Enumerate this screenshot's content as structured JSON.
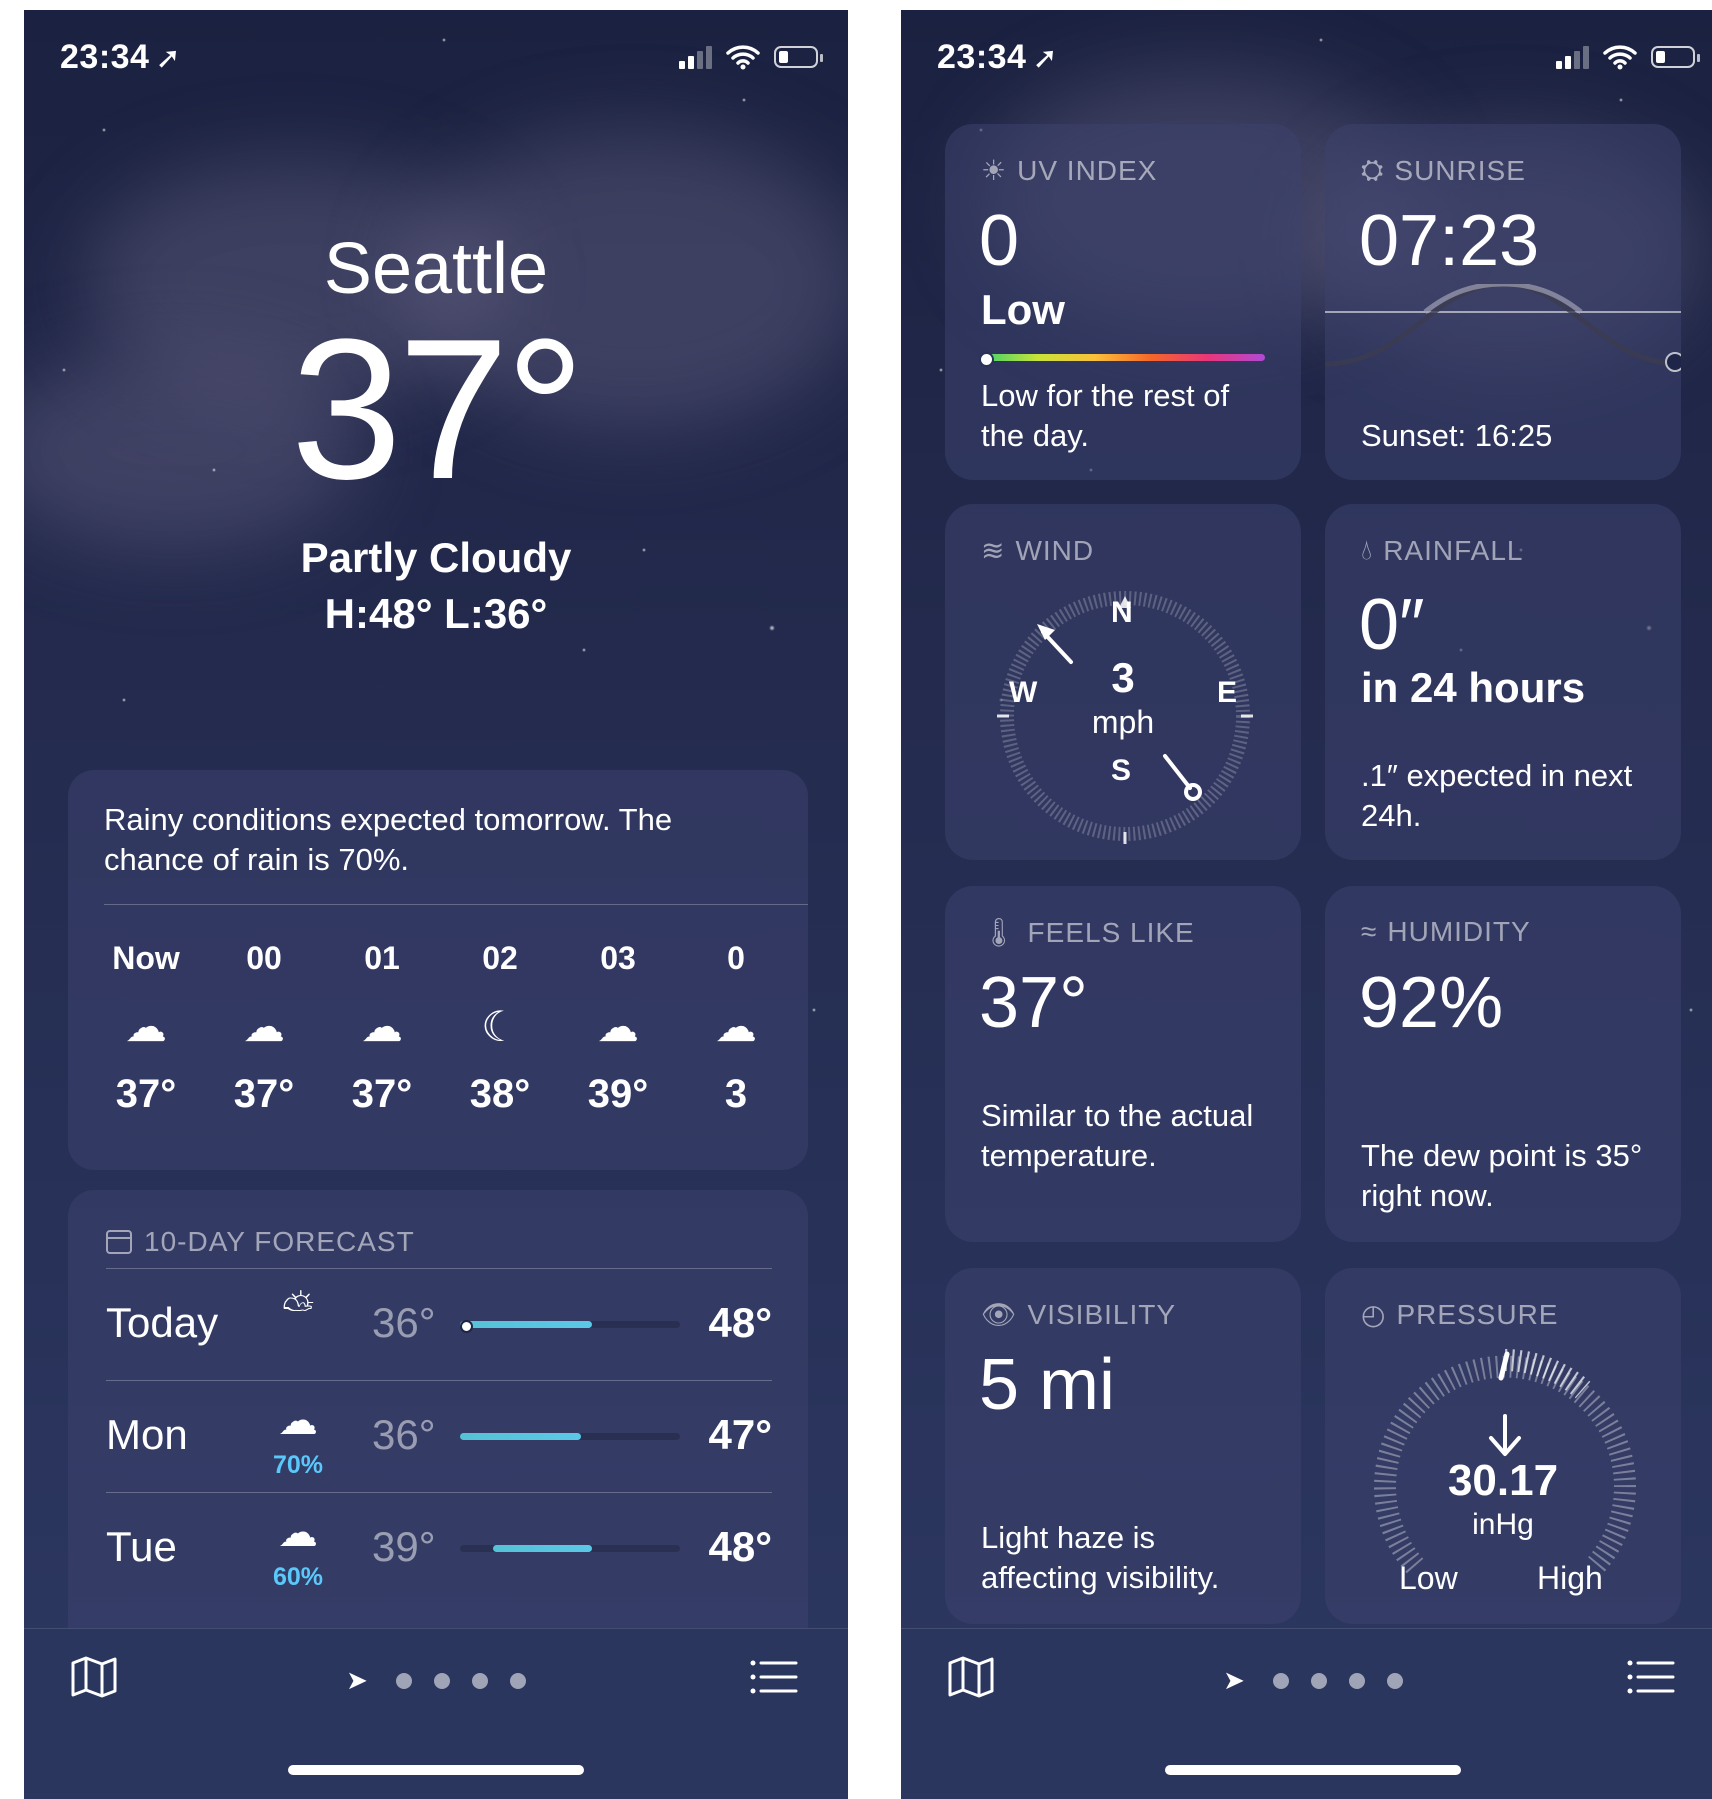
{
  "status": {
    "time": "23:34"
  },
  "left": {
    "city": "Seattle",
    "temperature": "37°",
    "condition": "Partly Cloudy",
    "high_low": "H:48°  L:36°",
    "hourly_summary": "Rainy conditions expected tomorrow. The chance of rain is 70%.",
    "hourly": [
      {
        "label": "Now",
        "icon": "cloud-moon-icon",
        "temp": "37°"
      },
      {
        "label": "00",
        "icon": "cloud-moon-icon",
        "temp": "37°"
      },
      {
        "label": "01",
        "icon": "cloud-moon-icon",
        "temp": "37°"
      },
      {
        "label": "02",
        "icon": "moon-stars-icon",
        "temp": "38°"
      },
      {
        "label": "03",
        "icon": "cloud-moon-icon",
        "temp": "39°"
      },
      {
        "label": "0",
        "icon": "cloud-moon-icon",
        "temp": "3"
      }
    ],
    "forecast_title": "10-DAY FORECAST",
    "forecast": [
      {
        "day": "Today",
        "icon": "cloud-sun-icon",
        "pct": "",
        "low": "36°",
        "high": "48°",
        "range_start": 0.0,
        "range_end": 0.6,
        "current": 0.0
      },
      {
        "day": "Mon",
        "icon": "cloud-rain-icon",
        "pct": "70%",
        "low": "36°",
        "high": "47°",
        "range_start": 0.0,
        "range_end": 0.55
      },
      {
        "day": "Tue",
        "icon": "cloud-rain-icon",
        "pct": "60%",
        "low": "39°",
        "high": "48°",
        "range_start": 0.15,
        "range_end": 0.6
      }
    ]
  },
  "right": {
    "uv": {
      "title": "UV INDEX",
      "value": "0",
      "level": "Low",
      "note": "Low for the rest of the day."
    },
    "sunrise": {
      "title": "SUNRISE",
      "time": "07:23",
      "sunset": "Sunset: 16:25"
    },
    "wind": {
      "title": "WIND",
      "speed": "3",
      "unit": "mph",
      "n": "N",
      "e": "E",
      "s": "S",
      "w": "W"
    },
    "rainfall": {
      "title": "RAINFALL",
      "value": "0″",
      "period": "in 24 hours",
      "note": ".1″ expected in next 24h."
    },
    "feels_like": {
      "title": "FEELS LIKE",
      "value": "37°",
      "note": "Similar to the actual temperature."
    },
    "humidity": {
      "title": "HUMIDITY",
      "value": "92%",
      "note": "The dew point is 35° right now."
    },
    "visibility": {
      "title": "VISIBILITY",
      "value": "5 mi",
      "note": "Light haze is affecting visibility."
    },
    "pressure": {
      "title": "PRESSURE",
      "value": "30.17",
      "unit": "inHg",
      "low": "Low",
      "high": "High"
    }
  },
  "nav": {
    "page_count": 4,
    "current_is_location": true
  },
  "colors": {
    "background_top": "#1b2140",
    "background_bottom": "#2d3862",
    "rain_pct": "#5ac8fa",
    "temp_bar": "#56c2d6"
  }
}
